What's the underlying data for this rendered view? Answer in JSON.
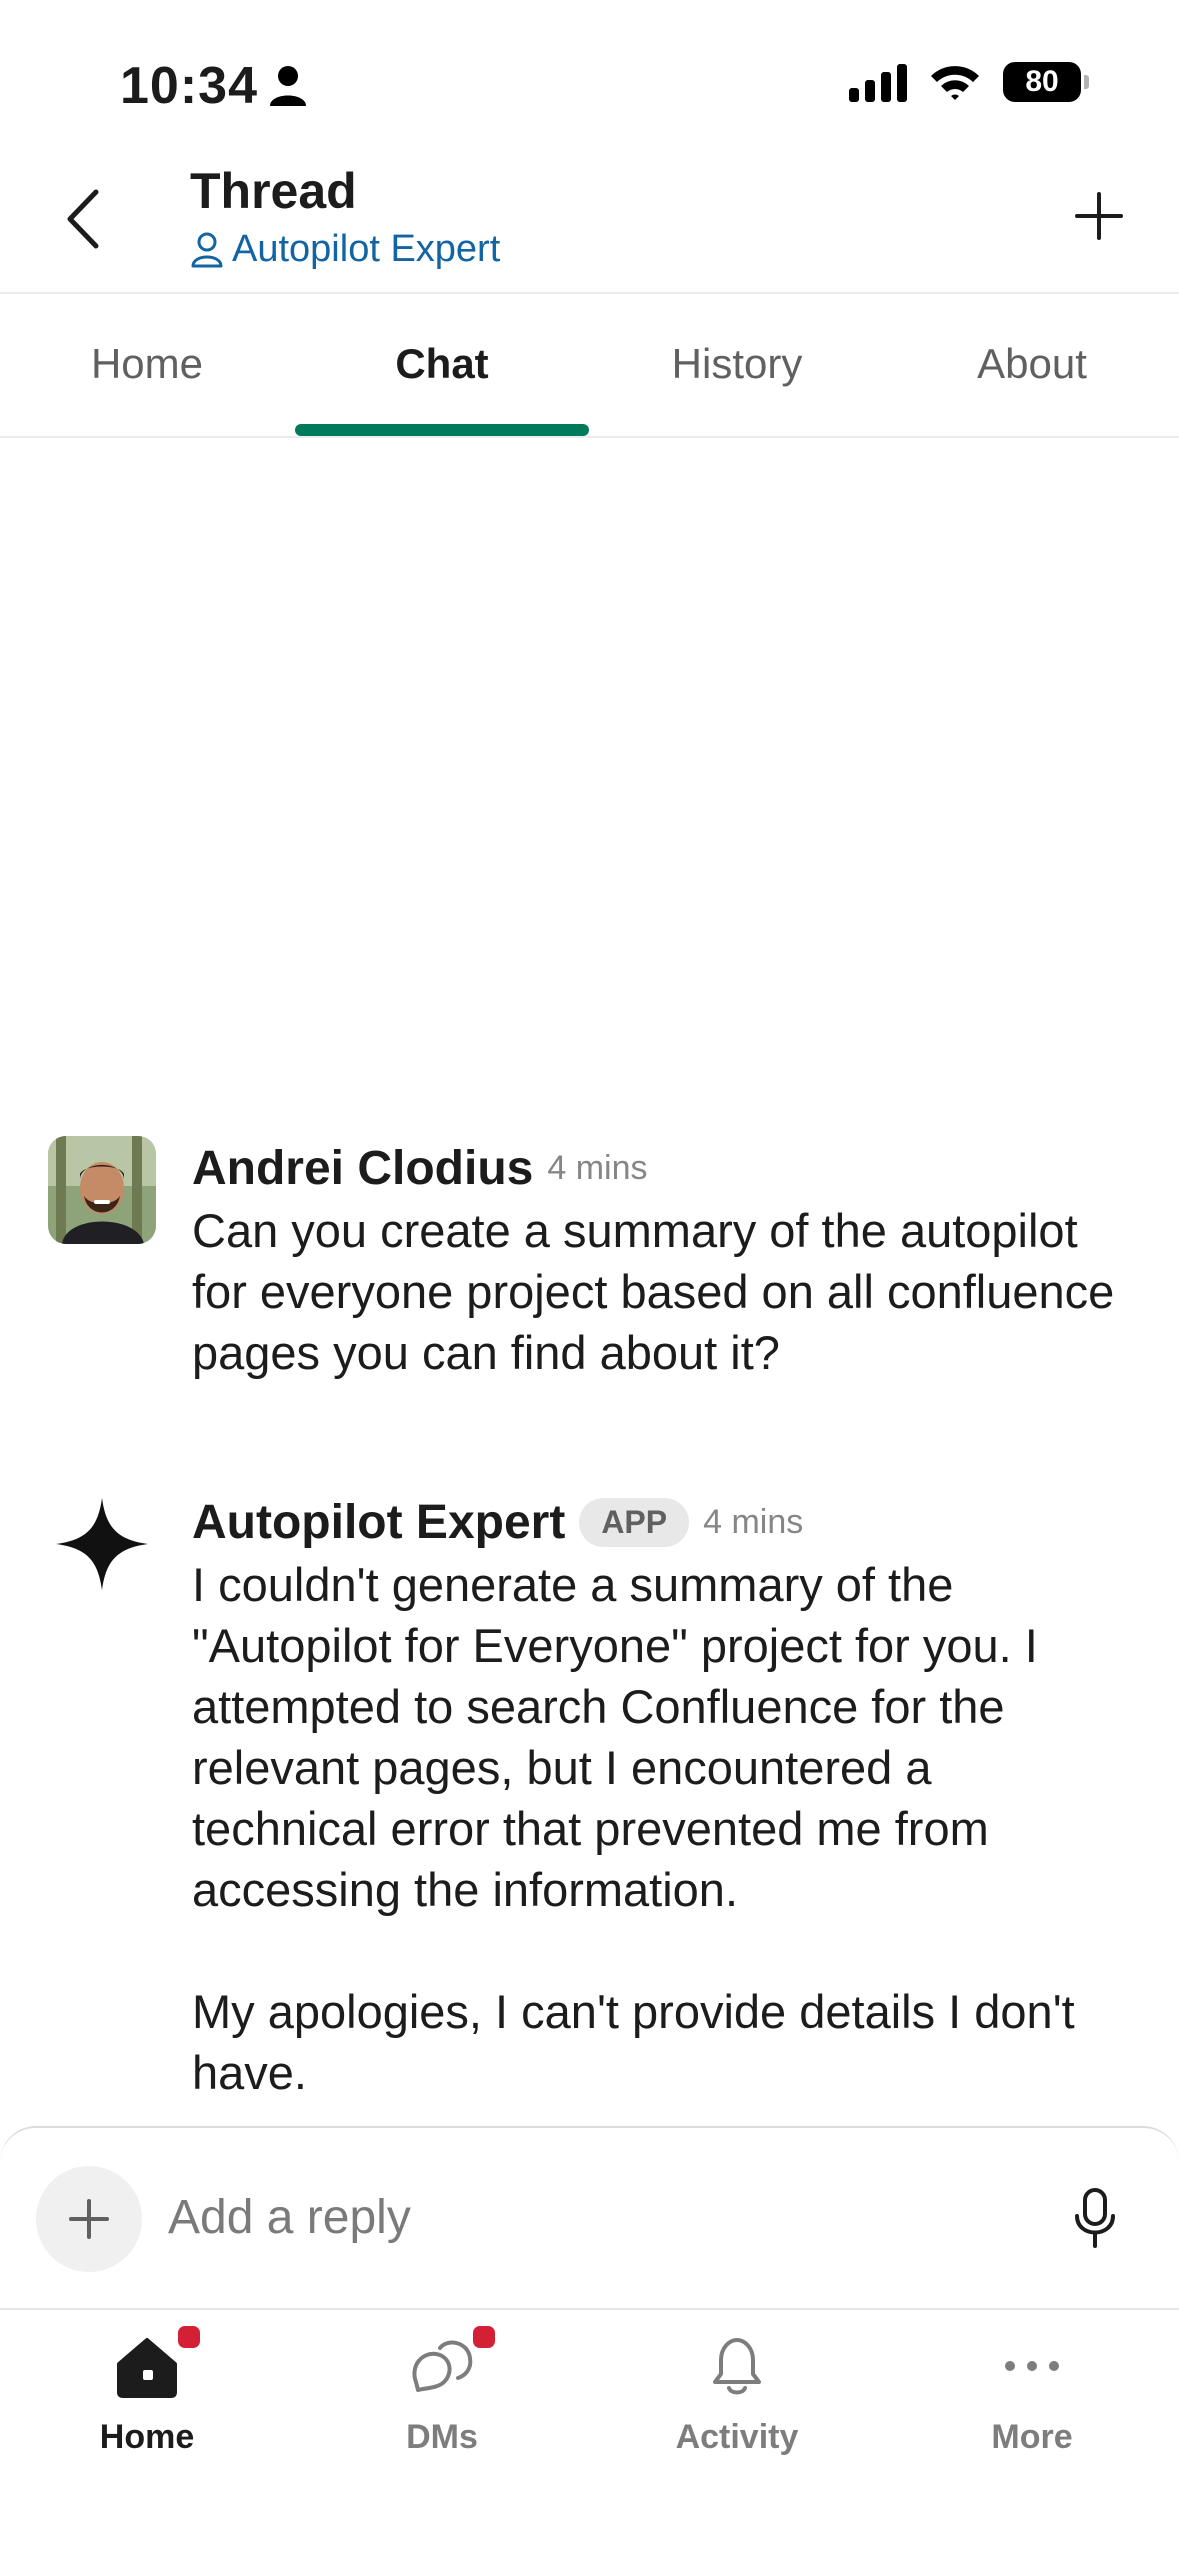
{
  "status_bar": {
    "time": "10:34",
    "battery": "80"
  },
  "header": {
    "title": "Thread",
    "subtitle": "Autopilot Expert"
  },
  "tabs": [
    {
      "label": "Home"
    },
    {
      "label": "Chat"
    },
    {
      "label": "History"
    },
    {
      "label": "About"
    }
  ],
  "active_tab": "Chat",
  "messages": [
    {
      "author": "Andrei Clodius",
      "time": "4 mins",
      "text": "Can you create a summary of the autopilot for everyone project based on all confluence pages you can find about it?"
    },
    {
      "author": "Autopilot Expert",
      "badge": "APP",
      "time": "4 mins",
      "text": "I couldn't generate a summary of the \"Autopilot for Everyone\" project for you. I attempted to search Confluence for the relevant pages, but I encountered a technical error that prevented me from accessing the information.\n\nMy apologies, I can't provide details I don't have."
    }
  ],
  "composer": {
    "placeholder": "Add a reply"
  },
  "nav": [
    {
      "label": "Home",
      "icon": "home-icon",
      "badge": true
    },
    {
      "label": "DMs",
      "icon": "dms-icon",
      "badge": true
    },
    {
      "label": "Activity",
      "icon": "bell-icon",
      "badge": false
    },
    {
      "label": "More",
      "icon": "more-icon",
      "badge": false
    }
  ],
  "colors": {
    "accent_tab": "#007a5a",
    "link": "#1264a3",
    "notification_dot": "#d32035"
  }
}
